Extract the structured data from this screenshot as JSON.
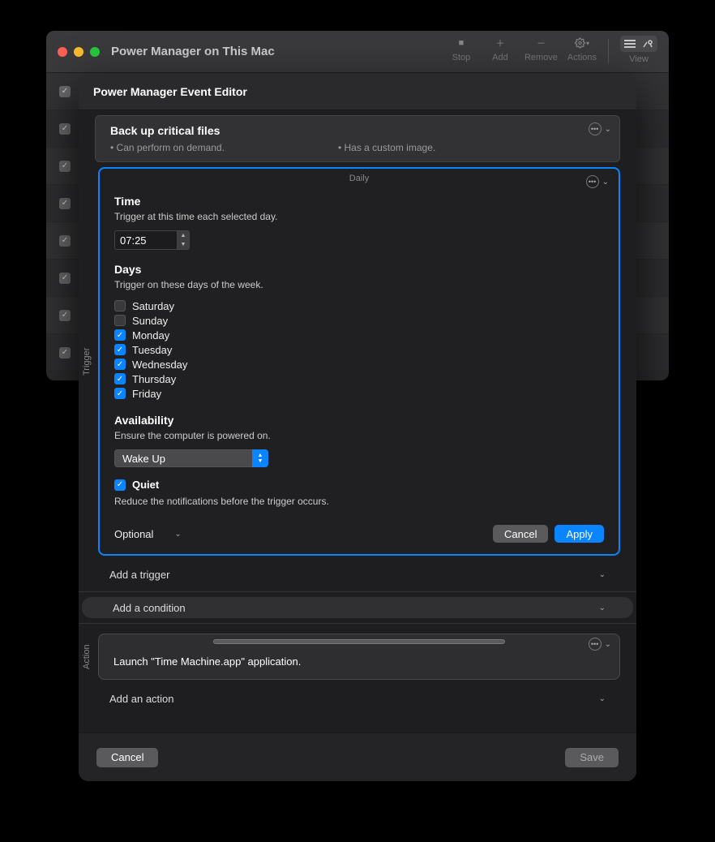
{
  "main_window": {
    "title": "Power Manager on This Mac",
    "toolbar": {
      "stop": "Stop",
      "add": "Add",
      "remove": "Remove",
      "actions": "Actions",
      "view": "View"
    }
  },
  "sheet": {
    "title": "Power Manager Event Editor",
    "summary": {
      "event_name": "Back up critical files",
      "note_demand": "• Can perform on demand.",
      "note_image": "• Has a custom image."
    },
    "side_trigger": "Trigger",
    "side_action": "Action",
    "trigger": {
      "type_label": "Daily",
      "time_heading": "Time",
      "time_sub": "Trigger at this time each selected day.",
      "time_value": "07:25",
      "days_heading": "Days",
      "days_sub": "Trigger on these days of the week.",
      "days": [
        {
          "label": "Saturday",
          "checked": false
        },
        {
          "label": "Sunday",
          "checked": false
        },
        {
          "label": "Monday",
          "checked": true
        },
        {
          "label": "Tuesday",
          "checked": true
        },
        {
          "label": "Wednesday",
          "checked": true
        },
        {
          "label": "Thursday",
          "checked": true
        },
        {
          "label": "Friday",
          "checked": true
        }
      ],
      "avail_heading": "Availability",
      "avail_sub": "Ensure the computer is powered on.",
      "avail_value": "Wake Up",
      "quiet_label": "Quiet",
      "quiet_checked": true,
      "quiet_sub": "Reduce the notifications before the trigger occurs.",
      "optional_label": "Optional",
      "cancel": "Cancel",
      "apply": "Apply"
    },
    "add_trigger": "Add a trigger",
    "add_condition": "Add a condition",
    "action": {
      "text": "Launch \"Time Machine.app\" application."
    },
    "add_action": "Add an action",
    "footer": {
      "cancel": "Cancel",
      "save": "Save"
    }
  }
}
